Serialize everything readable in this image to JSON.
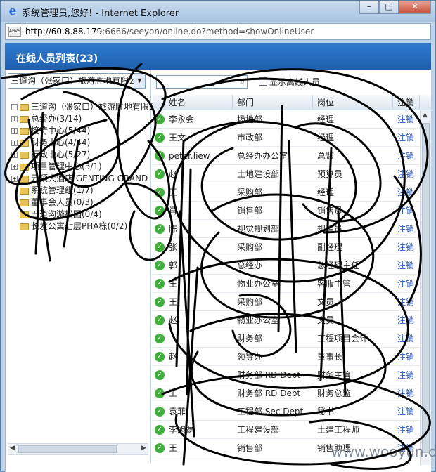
{
  "window": {
    "title": "系统管理员,您好! - Internet Explorer",
    "buttons": {
      "minimize": "–",
      "maximize": "□",
      "close": "✕"
    }
  },
  "address": {
    "site_icon": "ABVS",
    "url_host": "http://60.8.88.179",
    "url_rest": ":6666/seeyon/online.do?method=showOnlineUser"
  },
  "header": {
    "title": "在线人员列表(23)"
  },
  "left": {
    "org_select": "三道沟（张家口）旅游胜地有限公",
    "tree": [
      {
        "expander": "",
        "label": "三道沟（张家口）旅游胜地有限公司"
      },
      {
        "expander": "+",
        "label": "总经办(3/14)"
      },
      {
        "expander": "+",
        "label": "接待中心(5/44)"
      },
      {
        "expander": "+",
        "label": "财务中心(4/44)"
      },
      {
        "expander": "+",
        "label": "行政中心(5/27)"
      },
      {
        "expander": "+",
        "label": "项目管理中心(3/1)"
      },
      {
        "expander": "+",
        "label": "云顶大酒店 GENTING GRAND"
      },
      {
        "expander": "",
        "label": "系统管理组(1/7)"
      },
      {
        "expander": "",
        "label": "董事会人员(0/3)"
      },
      {
        "expander": "",
        "label": "五道沟游松园(0/4)"
      },
      {
        "expander": "",
        "label": "长发公寓七层PHA栋(0/2)"
      }
    ]
  },
  "toolbar": {
    "search_placeholder": "",
    "show_offline_label": "显示离线人员"
  },
  "grid": {
    "columns": [
      "姓名",
      "部门",
      "岗位",
      "注销"
    ],
    "rows": [
      {
        "name": "李永会",
        "dept": "场地部",
        "post": "经理",
        "op": "注销"
      },
      {
        "name": "王文",
        "dept": "市政部",
        "post": "经理",
        "op": "注销"
      },
      {
        "name": "peter.liew",
        "dept": "总经办办公室",
        "post": "总监",
        "op": "注销"
      },
      {
        "name": "赵",
        "dept": "土地建设部",
        "post": "预算员",
        "op": "注销"
      },
      {
        "name": "王",
        "dept": "采购部",
        "post": "经理",
        "op": "注销"
      },
      {
        "name": "肖",
        "dept": "销售部",
        "post": "销售员",
        "op": "注销"
      },
      {
        "name": "陈",
        "dept": "视觉规划部",
        "post": "规建员",
        "op": "注销"
      },
      {
        "name": "张",
        "dept": "采购部",
        "post": "副经理",
        "op": "注销"
      },
      {
        "name": "郭",
        "dept": "总经办",
        "post": "总经理主任",
        "op": "注销"
      },
      {
        "name": "王",
        "dept": "物业办公室",
        "post": "客服主管",
        "op": "注销"
      },
      {
        "name": "王",
        "dept": "采购部",
        "post": "文员",
        "op": "注销"
      },
      {
        "name": "赵",
        "dept": "物业办公室",
        "post": "文员",
        "op": "注销"
      },
      {
        "name": "",
        "dept": "财务部",
        "post": "工程项目会计",
        "op": "注销"
      },
      {
        "name": "赵",
        "dept": "领导办",
        "post": "董事长",
        "op": "注销"
      },
      {
        "name": "",
        "dept": "财务部 RD Dept",
        "post": "财务主管",
        "op": "注销"
      },
      {
        "name": "王",
        "dept": "财务部 RD Dept",
        "post": "财务总监",
        "op": "注销"
      },
      {
        "name": "袁菲",
        "dept": "工程部 Sec Dept",
        "post": "秘书",
        "op": "注销"
      },
      {
        "name": "李旭磊",
        "dept": "工程建设部",
        "post": "土建工程师",
        "op": "注销"
      },
      {
        "name": "王",
        "dept": "销售部",
        "post": "销售助理",
        "op": "注销"
      }
    ]
  },
  "watermark": "www.wooyun.org"
}
